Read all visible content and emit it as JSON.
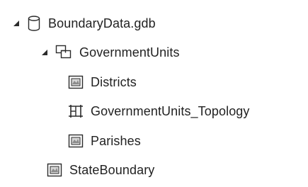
{
  "tree": {
    "root": {
      "label": "BoundaryData.gdb",
      "icon": "database-icon",
      "expanded": true
    },
    "dataset": {
      "label": "GovernmentUnits",
      "icon": "feature-dataset-icon",
      "expanded": true
    },
    "children": [
      {
        "label": "Districts",
        "icon": "polygon-feature-class-icon"
      },
      {
        "label": "GovernmentUnits_Topology",
        "icon": "topology-icon"
      },
      {
        "label": "Parishes",
        "icon": "polygon-feature-class-icon"
      }
    ],
    "standalone": {
      "label": "StateBoundary",
      "icon": "polygon-feature-class-icon"
    }
  }
}
